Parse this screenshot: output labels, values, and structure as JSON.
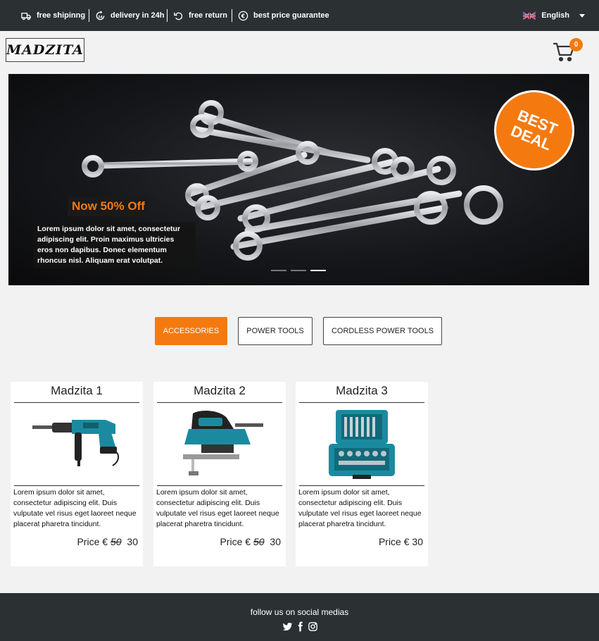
{
  "topbar": {
    "perks": [
      {
        "icon": "truck-icon",
        "label": "free shipinng"
      },
      {
        "icon": "clock-24-icon",
        "label": "delivery in 24h"
      },
      {
        "icon": "return-arrow-icon",
        "label": "free return"
      },
      {
        "icon": "euro-icon",
        "label": "best price guarantee"
      }
    ],
    "language": {
      "flag": "uk-flag-icon",
      "label": "English"
    }
  },
  "header": {
    "logo": "MADZITA",
    "cart": {
      "icon": "shopping-cart-icon",
      "count": "0"
    }
  },
  "hero": {
    "badge": [
      "BEST",
      "DEAL"
    ],
    "promo": "Now 50% Off",
    "text": "Lorem ipsum dolor sit amet, consectetur adipiscing elit. Proin maximus ultricies eros non dapibus. Donec elementum rhoncus nisl. Aliquam erat volutpat.",
    "slides": 3,
    "active_slide": 3
  },
  "categories": [
    {
      "label": "ACCESSORIES",
      "active": true
    },
    {
      "label": "POWER TOOLS",
      "active": false
    },
    {
      "label": "CORDLESS POWER TOOLS",
      "active": false
    }
  ],
  "products": [
    {
      "title": "Madzita 1",
      "image": "rotary-hammer-drill",
      "desc": "Lorem ipsum dolor sit amet, consectetur adipiscing elit. Duis vulputate vel risus eget laoreet neque placerat pharetra tincidunt.",
      "price_label": "Price",
      "currency": "€",
      "old_price": "50",
      "price": "30"
    },
    {
      "title": "Madzita 2",
      "image": "jigsaw",
      "desc": "Lorem ipsum dolor sit amet, consectetur adipiscing elit. Duis vulputate vel risus eget laoreet neque placerat pharetra tincidunt.",
      "price_label": "Price",
      "currency": "€",
      "old_price": "50",
      "price": "30"
    },
    {
      "title": "Madzita 3",
      "image": "tool-case-set",
      "desc": "Lorem ipsum dolor sit amet, consectetur adipiscing elit. Duis vulputate vel risus eget laoreet neque placerat pharetra tincidunt.",
      "price_label": "Price",
      "currency": "€",
      "old_price": "",
      "price": "30"
    }
  ],
  "footer": {
    "text": "follow us on social medias",
    "socials": [
      "twitter-icon",
      "facebook-icon",
      "instagram-icon"
    ]
  },
  "colors": {
    "accent": "#f47a10",
    "dark_bar": "#2b3133",
    "page_bg": "#f2f2f2"
  }
}
